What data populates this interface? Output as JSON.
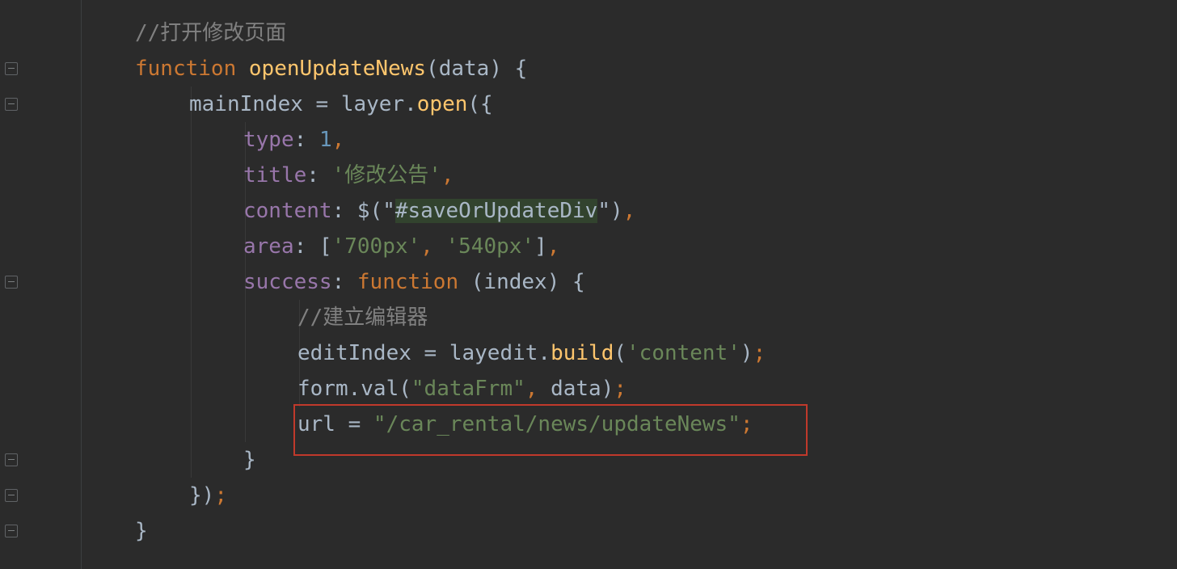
{
  "editor": {
    "lines": [
      {
        "indent": 1,
        "tokens": [
          {
            "t": "cmt",
            "v": "//打开修改页面"
          }
        ]
      },
      {
        "indent": 1,
        "tokens": [
          {
            "t": "kw",
            "v": "function"
          },
          {
            "t": "txt",
            "v": " "
          },
          {
            "t": "fn",
            "v": "openUpdateNews"
          },
          {
            "t": "txt",
            "v": "(data) {"
          }
        ]
      },
      {
        "indent": 2,
        "tokens": [
          {
            "t": "txt",
            "v": "mainIndex = layer."
          },
          {
            "t": "fn",
            "v": "open"
          },
          {
            "t": "txt",
            "v": "({"
          }
        ]
      },
      {
        "indent": 3,
        "tokens": [
          {
            "t": "prop",
            "v": "type"
          },
          {
            "t": "txt",
            "v": ": "
          },
          {
            "t": "num",
            "v": "1"
          },
          {
            "t": "kw",
            "v": ","
          }
        ]
      },
      {
        "indent": 3,
        "tokens": [
          {
            "t": "prop",
            "v": "title"
          },
          {
            "t": "txt",
            "v": ": "
          },
          {
            "t": "str",
            "v": "'修改公告'"
          },
          {
            "t": "kw",
            "v": ","
          }
        ]
      },
      {
        "indent": 3,
        "tokens": [
          {
            "t": "prop",
            "v": "content"
          },
          {
            "t": "txt",
            "v": ": $(\""
          },
          {
            "t": "sel",
            "v": "#saveOrUpdateDiv"
          },
          {
            "t": "txt",
            "v": "\")"
          },
          {
            "t": "kw",
            "v": ","
          }
        ]
      },
      {
        "indent": 3,
        "tokens": [
          {
            "t": "prop",
            "v": "area"
          },
          {
            "t": "txt",
            "v": ": ["
          },
          {
            "t": "str",
            "v": "'700px'"
          },
          {
            "t": "kw",
            "v": ","
          },
          {
            "t": "txt",
            "v": " "
          },
          {
            "t": "str",
            "v": "'540px'"
          },
          {
            "t": "txt",
            "v": "]"
          },
          {
            "t": "kw",
            "v": ","
          }
        ]
      },
      {
        "indent": 3,
        "tokens": [
          {
            "t": "prop",
            "v": "success"
          },
          {
            "t": "txt",
            "v": ": "
          },
          {
            "t": "kw",
            "v": "function"
          },
          {
            "t": "txt",
            "v": " (index) {"
          }
        ]
      },
      {
        "indent": 4,
        "tokens": [
          {
            "t": "cmt",
            "v": "//建立编辑器"
          }
        ]
      },
      {
        "indent": 4,
        "tokens": [
          {
            "t": "txt",
            "v": "editIndex = layedit."
          },
          {
            "t": "fn",
            "v": "build"
          },
          {
            "t": "txt",
            "v": "("
          },
          {
            "t": "str",
            "v": "'content'"
          },
          {
            "t": "txt",
            "v": ")"
          },
          {
            "t": "kw",
            "v": ";"
          }
        ]
      },
      {
        "indent": 4,
        "tokens": [
          {
            "t": "txt",
            "v": "form.val("
          },
          {
            "t": "str",
            "v": "\"dataFrm\""
          },
          {
            "t": "kw",
            "v": ","
          },
          {
            "t": "txt",
            "v": " data)"
          },
          {
            "t": "kw",
            "v": ";"
          }
        ]
      },
      {
        "indent": 4,
        "tokens": [
          {
            "t": "txt",
            "v": "url = "
          },
          {
            "t": "str",
            "v": "\"/car_rental/news/updateNews\""
          },
          {
            "t": "kw",
            "v": ";"
          }
        ]
      },
      {
        "indent": 3,
        "tokens": [
          {
            "t": "txt",
            "v": "}"
          }
        ]
      },
      {
        "indent": 2,
        "tokens": [
          {
            "t": "txt",
            "v": "})"
          },
          {
            "t": "kw",
            "v": ";"
          }
        ]
      },
      {
        "indent": 1,
        "tokens": [
          {
            "t": "txt",
            "v": "}"
          }
        ]
      }
    ],
    "colors": {
      "background": "#2b2b2b",
      "keyword": "#cc7832",
      "function": "#ffc66d",
      "string": "#6a8759",
      "number": "#6897bb",
      "property": "#9876aa",
      "comment": "#808080",
      "text": "#a9b7c6",
      "highlight_box": "#c0392b"
    },
    "fold_markers": [
      {
        "line": 1,
        "icon": "fold-open-icon"
      },
      {
        "line": 2,
        "icon": "fold-open-icon"
      },
      {
        "line": 7,
        "icon": "fold-open-icon"
      },
      {
        "line": 12,
        "icon": "fold-close-icon"
      },
      {
        "line": 13,
        "icon": "fold-close-icon"
      },
      {
        "line": 14,
        "icon": "fold-close-icon"
      }
    ],
    "highlighted_line": 11
  }
}
